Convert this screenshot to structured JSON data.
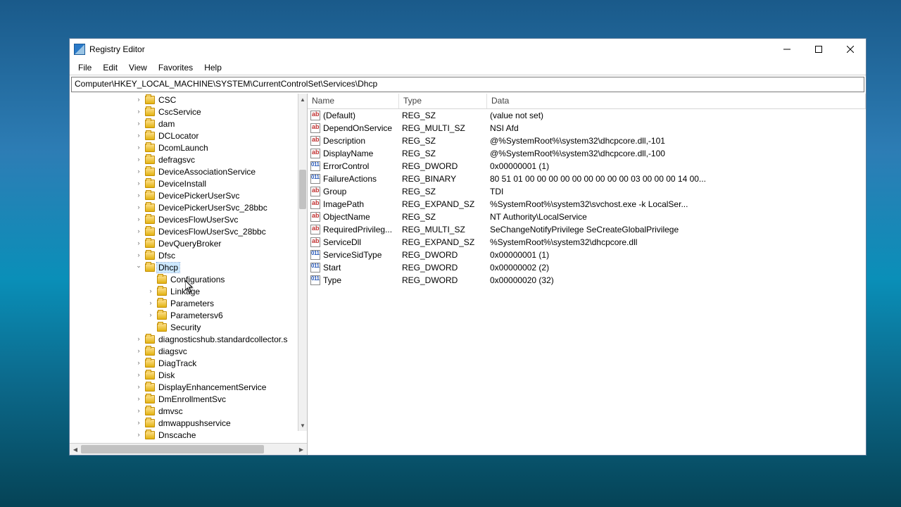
{
  "window": {
    "title": "Registry Editor"
  },
  "menu": {
    "items": [
      "File",
      "Edit",
      "View",
      "Favorites",
      "Help"
    ]
  },
  "address": "Computer\\HKEY_LOCAL_MACHINE\\SYSTEM\\CurrentControlSet\\Services\\Dhcp",
  "columns": {
    "name": "Name",
    "type": "Type",
    "data": "Data"
  },
  "tree": [
    {
      "label": "CSC",
      "depth": 0,
      "exp": ">"
    },
    {
      "label": "CscService",
      "depth": 0,
      "exp": ">"
    },
    {
      "label": "dam",
      "depth": 0,
      "exp": ">"
    },
    {
      "label": "DCLocator",
      "depth": 0,
      "exp": ">"
    },
    {
      "label": "DcomLaunch",
      "depth": 0,
      "exp": ">"
    },
    {
      "label": "defragsvc",
      "depth": 0,
      "exp": ">"
    },
    {
      "label": "DeviceAssociationService",
      "depth": 0,
      "exp": ">"
    },
    {
      "label": "DeviceInstall",
      "depth": 0,
      "exp": ">"
    },
    {
      "label": "DevicePickerUserSvc",
      "depth": 0,
      "exp": ">"
    },
    {
      "label": "DevicePickerUserSvc_28bbc",
      "depth": 0,
      "exp": ">"
    },
    {
      "label": "DevicesFlowUserSvc",
      "depth": 0,
      "exp": ">"
    },
    {
      "label": "DevicesFlowUserSvc_28bbc",
      "depth": 0,
      "exp": ">"
    },
    {
      "label": "DevQueryBroker",
      "depth": 0,
      "exp": ">"
    },
    {
      "label": "Dfsc",
      "depth": 0,
      "exp": ">"
    },
    {
      "label": "Dhcp",
      "depth": 0,
      "exp": "v",
      "selected": true
    },
    {
      "label": "Configurations",
      "depth": 1,
      "exp": ""
    },
    {
      "label": "Linkage",
      "depth": 1,
      "exp": ">"
    },
    {
      "label": "Parameters",
      "depth": 1,
      "exp": ">"
    },
    {
      "label": "Parametersv6",
      "depth": 1,
      "exp": ">"
    },
    {
      "label": "Security",
      "depth": 1,
      "exp": ""
    },
    {
      "label": "diagnosticshub.standardcollector.s",
      "depth": 0,
      "exp": ">"
    },
    {
      "label": "diagsvc",
      "depth": 0,
      "exp": ">"
    },
    {
      "label": "DiagTrack",
      "depth": 0,
      "exp": ">"
    },
    {
      "label": "Disk",
      "depth": 0,
      "exp": ">"
    },
    {
      "label": "DisplayEnhancementService",
      "depth": 0,
      "exp": ">"
    },
    {
      "label": "DmEnrollmentSvc",
      "depth": 0,
      "exp": ">"
    },
    {
      "label": "dmvsc",
      "depth": 0,
      "exp": ">"
    },
    {
      "label": "dmwappushservice",
      "depth": 0,
      "exp": ">"
    },
    {
      "label": "Dnscache",
      "depth": 0,
      "exp": ">"
    }
  ],
  "values": [
    {
      "name": "(Default)",
      "type": "REG_SZ",
      "data": "(value not set)",
      "icon": "str"
    },
    {
      "name": "DependOnService",
      "type": "REG_MULTI_SZ",
      "data": "NSI Afd",
      "icon": "str"
    },
    {
      "name": "Description",
      "type": "REG_SZ",
      "data": "@%SystemRoot%\\system32\\dhcpcore.dll,-101",
      "icon": "str"
    },
    {
      "name": "DisplayName",
      "type": "REG_SZ",
      "data": "@%SystemRoot%\\system32\\dhcpcore.dll,-100",
      "icon": "str"
    },
    {
      "name": "ErrorControl",
      "type": "REG_DWORD",
      "data": "0x00000001 (1)",
      "icon": "bin"
    },
    {
      "name": "FailureActions",
      "type": "REG_BINARY",
      "data": "80 51 01 00 00 00 00 00 00 00 00 00 03 00 00 00 14 00...",
      "icon": "bin"
    },
    {
      "name": "Group",
      "type": "REG_SZ",
      "data": "TDI",
      "icon": "str"
    },
    {
      "name": "ImagePath",
      "type": "REG_EXPAND_SZ",
      "data": "%SystemRoot%\\system32\\svchost.exe -k LocalSer...",
      "icon": "str"
    },
    {
      "name": "ObjectName",
      "type": "REG_SZ",
      "data": "NT Authority\\LocalService",
      "icon": "str"
    },
    {
      "name": "RequiredPrivileg...",
      "type": "REG_MULTI_SZ",
      "data": "SeChangeNotifyPrivilege SeCreateGlobalPrivilege",
      "icon": "str"
    },
    {
      "name": "ServiceDll",
      "type": "REG_EXPAND_SZ",
      "data": "%SystemRoot%\\system32\\dhcpcore.dll",
      "icon": "str"
    },
    {
      "name": "ServiceSidType",
      "type": "REG_DWORD",
      "data": "0x00000001 (1)",
      "icon": "bin"
    },
    {
      "name": "Start",
      "type": "REG_DWORD",
      "data": "0x00000002 (2)",
      "icon": "bin"
    },
    {
      "name": "Type",
      "type": "REG_DWORD",
      "data": "0x00000020 (32)",
      "icon": "bin"
    }
  ]
}
